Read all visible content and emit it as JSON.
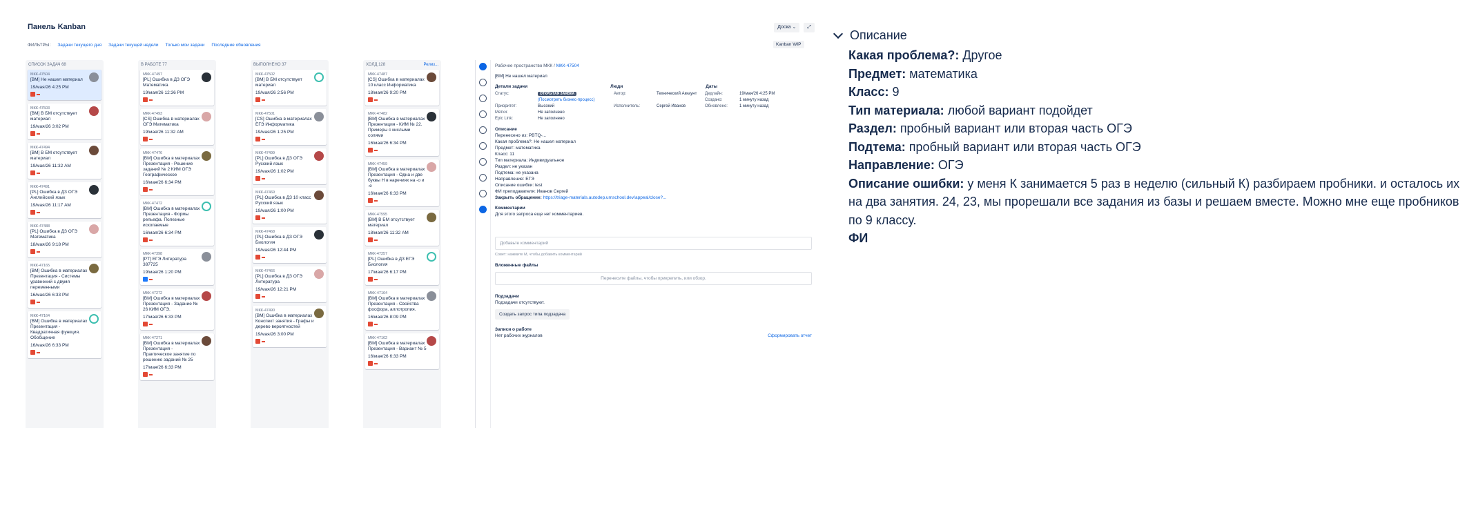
{
  "board": {
    "title": "Панель Kanban",
    "filters_label": "ФИЛЬТРЫ:",
    "filters": [
      "Задачи текущего дня",
      "Задачи текущей недели",
      "Только мои задачи",
      "Последние обновления"
    ],
    "board_button": "Доска ⌄",
    "expand_icon": "expand-icon",
    "wip_button": "Kanban WIP",
    "columns": [
      {
        "title": "СПИСОК ЗАДАЧ 68",
        "action": "",
        "cards": [
          {
            "key": "МКК-47504",
            "summary": "[ВМ] Не нашел материал",
            "date": "19/мая/26 4:25 PM",
            "selected": true
          },
          {
            "key": "МКК-47503",
            "summary": "[ВМ] В БМ отсутствует материал",
            "date": "19/мая/26 3:02 PM"
          },
          {
            "key": "МКК-47494",
            "summary": "[ВМ] В БМ отсутствует материал",
            "date": "19/мая/26 11:32 AM"
          },
          {
            "key": "МКК-47491",
            "summary": "[PL] Ошибка в ДЗ ОГЭ Английский язык",
            "date": "19/мая/26 11:17 AM"
          },
          {
            "key": "МКК-47488",
            "summary": "[PL] Ошибка в ДЗ ОГЭ Математика",
            "date": "18/мая/26 9:18 PM"
          },
          {
            "key": "МКК-47165",
            "summary": "[ВМ] Ошибка в материалах Презентация - Системы уравнений с двумя переменными",
            "date": "16/мая/26 6:33 PM"
          },
          {
            "key": "МКК-47164",
            "summary": "[ВМ] Ошибка в материалах Презентация - Квадратичная функция. Обобщение",
            "date": "16/мая/26 6:33 PM"
          }
        ]
      },
      {
        "title": "В РАБОТЕ 77",
        "action": "",
        "cards": [
          {
            "key": "МКК-47497",
            "summary": "[PL] Ошибка в ДЗ ОГЭ Математика",
            "date": "19/мая/26 12:36 PM"
          },
          {
            "key": "МКК-47493",
            "summary": "[CS] Ошибка в материалах ОГЭ Математика",
            "date": "19/мая/26 11:32 AM"
          },
          {
            "key": "МКК-47476",
            "summary": "[ВМ] Ошибка в материалах Презентация - Решение заданий № 2 КИМ ОГЭ Географическое",
            "date": "16/мая/26 6:34 PM"
          },
          {
            "key": "МКК-47472",
            "summary": "[ВМ] Ошибка в материалах Презентация - Формы рельефа. Полезные ископаемые",
            "date": "16/мая/26 6:34 PM"
          },
          {
            "key": "МКК-47398",
            "summary": "[PT] ЕГЭ Литература 387725",
            "date": "19/мая/26 1:20 PM"
          },
          {
            "key": "МКК-47272",
            "summary": "[ВМ] Ошибка в материалах Презентация - Задание № 26 КИМ ОГЭ.",
            "date": "17/мая/26 6:33 PM"
          },
          {
            "key": "МКК-47271",
            "summary": "[ВМ] Ошибка в материалах Презентация - Практическое занятие по решению заданий № 25",
            "date": "17/мая/26 6:33 PM"
          }
        ]
      },
      {
        "title": "ВЫПОЛНЕНО 37",
        "action": "",
        "cards": [
          {
            "key": "МКК-47502",
            "summary": "[ВМ] В БМ отсутствует материал",
            "date": "19/мая/26 2:56 PM"
          },
          {
            "key": "МКК-47501",
            "summary": "[CS] Ошибка в материалах ЕГЭ Информатика",
            "date": "19/мая/26 1:25 PM"
          },
          {
            "key": "МКК-47499",
            "summary": "[PL] Ошибка в ДЗ ОГЭ Русский язык",
            "date": "19/мая/26 1:02 PM"
          },
          {
            "key": "МКК-47469",
            "summary": "[PL] Ошибка в ДЗ 10 класс Русский язык",
            "date": "19/мая/26 1:00 PM"
          },
          {
            "key": "МКК-47468",
            "summary": "[PL] Ошибка в ДЗ ОГЭ Биология",
            "date": "19/мая/26 12:44 PM"
          },
          {
            "key": "МКК-47466",
            "summary": "[PL] Ошибка в ДЗ ОГЭ Литература",
            "date": "19/мая/26 12:21 PM"
          },
          {
            "key": "МКК-47490",
            "summary": "[ВМ] Ошибка в материалах Конспект занятия - Графы и дерево вероятностей",
            "date": "19/мая/26 3:00 PM"
          }
        ]
      },
      {
        "title": "ХОЛД 128",
        "action": "Релиз...",
        "cards": [
          {
            "key": "МКК-47487",
            "summary": "[CS] Ошибка в материалах 10 класс Информатика",
            "date": "18/мая/26 9:20 PM"
          },
          {
            "key": "МКК-47482",
            "summary": "[ВМ] Ошибка в материалах Презентация - КИМ № 22. Примеры с кислыми солями",
            "date": "16/мая/26 6:34 PM"
          },
          {
            "key": "МКК-47459",
            "summary": "[ВМ] Ошибка в материалах Презентация - Одна и две буквы Н в наречиях на -о и -е",
            "date": "16/мая/26 6:33 PM"
          },
          {
            "key": "МКК-47595",
            "summary": "[ВМ] В БМ отсутствует материал",
            "date": "18/мая/26 11:32 AM"
          },
          {
            "key": "МКК-47257",
            "summary": "[PL] Ошибка в ДЗ ЕГЭ Биология",
            "date": "17/мая/26 6:17 PM"
          },
          {
            "key": "МКК-47164",
            "summary": "[ВМ] Ошибка в материалах Презентация - Свойства фосфора, аллотропия.",
            "date": "16/мая/26 8:09 PM"
          },
          {
            "key": "МКК-47162",
            "summary": "[ВМ] Ошибка в материалах Презентация - Вариант № 5",
            "date": "16/мая/26 6:33 PM"
          }
        ]
      }
    ]
  },
  "detail": {
    "crumb_prefix": "Рабочее пространство МКК /",
    "crumb_key": "МКК-47504",
    "title": "[ВМ] Не нашел материал",
    "sec_details": "Детали задачи",
    "sec_people": "Люди",
    "sec_dates": "Даты",
    "status_label": "Статус:",
    "status_value": "ОТКРЫТАЯ ЗАЯВКА",
    "bp_link": "(Посмотреть бизнес-процесс)",
    "priority_label": "Приоритет:",
    "priority_value": "Высокий",
    "labels_label": "Метки:",
    "labels_value": "Не заполнено",
    "epic_label": "Epic Link:",
    "epic_value": "Не заполнено",
    "author_label": "Автор:",
    "author_value": "Технический Аккаунт",
    "assignee_label": "Исполнитель:",
    "assignee_value": "Сергей Иванов",
    "deadline_label": "Дедлайн:",
    "deadline_value": "19/мая/26 4:25 PM",
    "created_label": "Создано:",
    "created_value": "1 минуту назад",
    "updated_label": "Обновлено:",
    "updated_value": "1 минуту назад",
    "sec_description": "Описание",
    "desc_lines": [
      "Перенесено из: PBTQ-...",
      "Какая проблема?: Не нашел материал",
      "Предмет: математика",
      "Класс: 11",
      "Тип материала: Индивидуальное",
      "Раздел: не указан",
      "Подтема: не указана",
      "Направление: ЕГЭ",
      "Описание ошибки: test",
      "ФИ преподавателя: Иванов Сергей"
    ],
    "close_label": "Закрыть обращение:",
    "close_link": "https://triage-materials.autodep.umschool.dev/appeal/close?...",
    "sec_comments": "Комментарии",
    "no_comments": "Для этого запроса еще нет комментариев.",
    "add_comment": "Добавьте комментарий",
    "tip": "Совет: нажмите M, чтобы добавить комментарий",
    "sec_files": "Вложенные файлы",
    "drop_text": "Перенесите файлы, чтобы прикрепить, или обзор.",
    "sec_subtasks": "Подзадачи",
    "no_subtasks": "Подзадачи отсутствуют.",
    "create_subtask": "Создать запрос типа подзадача",
    "sec_worklog": "Записи о работе",
    "no_worklog": "Нет рабочих журналов",
    "report_link": "Сформировать отчет"
  },
  "zoom": {
    "header": "Описание",
    "lines": [
      {
        "k": "Какая проблема?:",
        "v": " Другое"
      },
      {
        "k": "Предмет:",
        "v": " математика"
      },
      {
        "k": "Класс:",
        "v": " 9"
      },
      {
        "k": "Тип материала:",
        "v": " любой вариант подойдет"
      },
      {
        "k": "Раздел:",
        "v": " пробный вариант или вторая часть ОГЭ"
      },
      {
        "k": "Подтема:",
        "v": " пробный вариант или вторая часть ОГЭ"
      },
      {
        "k": "Направление:",
        "v": " ОГЭ"
      },
      {
        "k": "Описание ошибки:",
        "v": " у меня К занимается 5 раз в неделю (сильный К) разбираем пробники. и осталось их"
      }
    ],
    "cont1": "на два занятия. 24, 23, мы прорешали все задания из базы и решаем вместе. Можно мне еще пробников",
    "cont2": "по 9 классу.",
    "last_key": "ФИ"
  }
}
